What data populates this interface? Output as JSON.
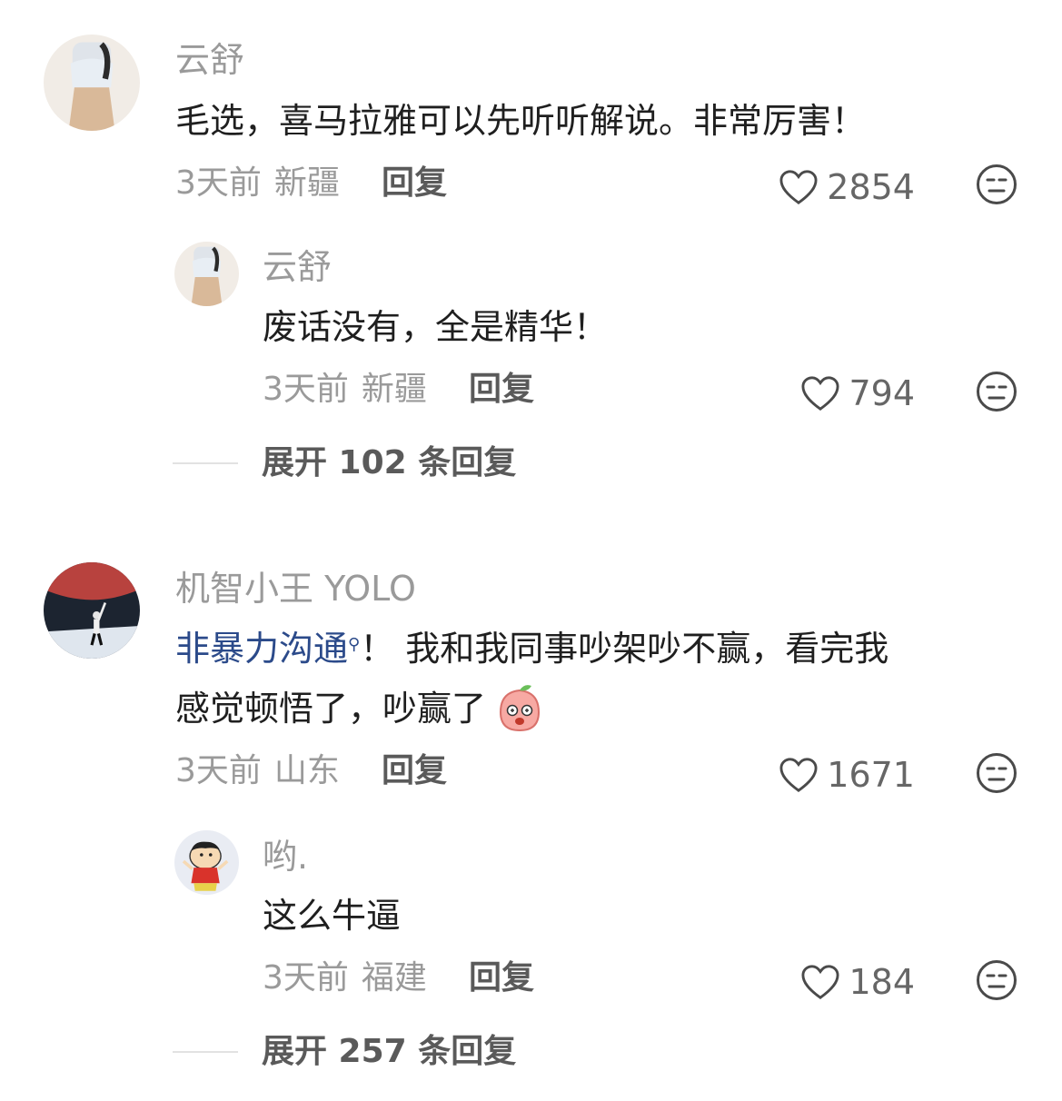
{
  "comments": [
    {
      "name": "云舒",
      "text": "毛选，喜马拉雅可以先听听解说。非常厉害！",
      "time": "3天前",
      "location": "新疆",
      "reply_label": "回复",
      "likes": "2854",
      "reply": {
        "name": "云舒",
        "text": "废话没有，全是精华！",
        "time": "3天前",
        "location": "新疆",
        "reply_label": "回复",
        "likes": "794"
      },
      "expand_label": "展开 102 条回复"
    },
    {
      "name": "机智小王 YOLO",
      "topic": "非暴力沟通",
      "text_after_topic": "！ 我和我同事吵架吵不赢，看完我",
      "text_line2": "感觉顿悟了，吵赢了",
      "emoji": "peach-face-emoji",
      "time": "3天前",
      "location": "山东",
      "reply_label": "回复",
      "likes": "1671",
      "reply": {
        "name": "哟.",
        "text": "这么牛逼",
        "time": "3天前",
        "location": "福建",
        "reply_label": "回复",
        "likes": "184"
      },
      "expand_label": "展开 257 条回复"
    }
  ],
  "icons": {
    "like": "heart-outline-icon",
    "dislike": "neutral-face-icon",
    "topic_search": "search-mini-icon"
  },
  "colors": {
    "text": "#1f1f1f",
    "secondary": "#9a9a9a",
    "topic": "#2b4a8a"
  }
}
